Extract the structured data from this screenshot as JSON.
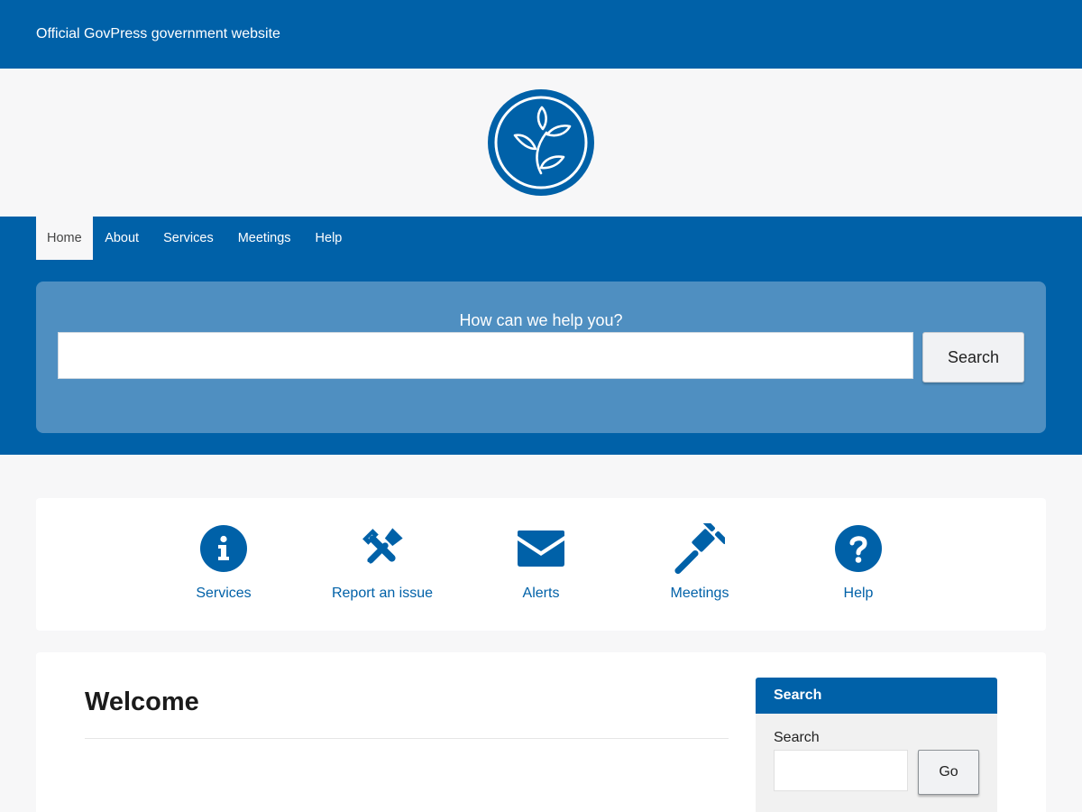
{
  "header": {
    "banner_text": "Official GovPress government website"
  },
  "nav": {
    "items": [
      {
        "label": "Home",
        "active": true
      },
      {
        "label": "About"
      },
      {
        "label": "Services"
      },
      {
        "label": "Meetings"
      },
      {
        "label": "Help"
      }
    ]
  },
  "hero": {
    "label": "How can we help you?",
    "input_value": "",
    "button_label": "Search"
  },
  "quicklinks": [
    {
      "label": "Services",
      "icon": "info-icon"
    },
    {
      "label": "Report an issue",
      "icon": "tools-icon"
    },
    {
      "label": "Alerts",
      "icon": "envelope-icon"
    },
    {
      "label": "Meetings",
      "icon": "gavel-icon"
    },
    {
      "label": "Help",
      "icon": "question-icon"
    }
  ],
  "main": {
    "title": "Welcome"
  },
  "sidebar": {
    "widget_title": "Search",
    "field_label": "Search",
    "input_value": "",
    "button_label": "Go"
  },
  "colors": {
    "brand_blue": "#0061a8",
    "hero_blue": "#4f8fc1",
    "page_bg": "#f7f7f8"
  }
}
